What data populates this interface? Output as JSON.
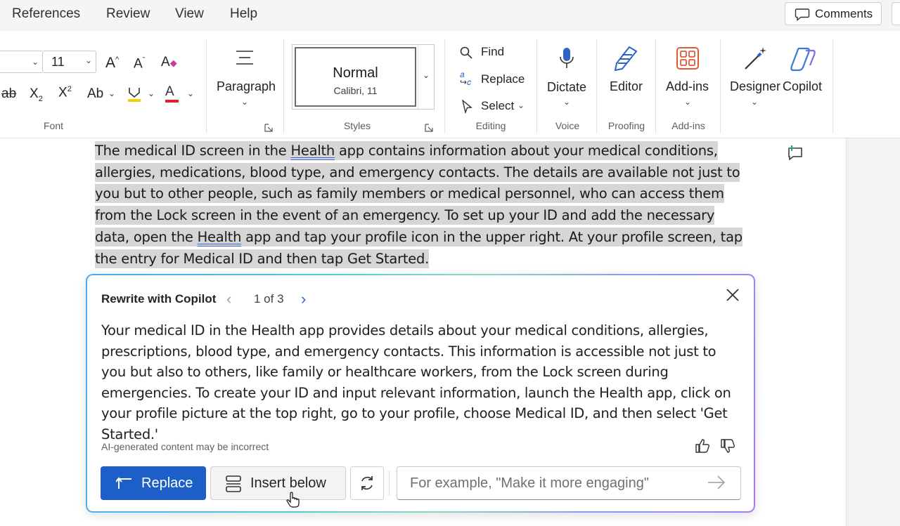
{
  "menu": {
    "items": [
      "References",
      "Review",
      "View",
      "Help"
    ],
    "comments_label": "Comments"
  },
  "ribbon": {
    "font": {
      "size": "11",
      "group_label": "Font",
      "grow_icon": "A^",
      "shrink_icon": "Aˇ",
      "change_case": "Aa",
      "subscript": "X2",
      "superscript": "X2"
    },
    "paragraph": {
      "label": "Paragraph"
    },
    "styles": {
      "current_style": "Normal",
      "current_font": "Calibri, 11",
      "group_label": "Styles"
    },
    "editing": {
      "find": "Find",
      "replace": "Replace",
      "select": "Select",
      "group_label": "Editing"
    },
    "voice": {
      "dictate": "Dictate",
      "group_label": "Voice"
    },
    "proofing": {
      "editor": "Editor",
      "group_label": "Proofing"
    },
    "addins": {
      "label": "Add-ins",
      "group_label": "Add-ins"
    },
    "designer": "Designer",
    "copilot": "Copilot",
    "colors": {
      "font_color_bar": "#e0202a",
      "highlight_bar": "#f2d200",
      "accent": "#1d5fc9"
    }
  },
  "document": {
    "paragraph_parts": [
      "The medical ID screen in the ",
      "Health",
      " app contains information about your medical conditions, allergies, medications, blood type, and emergency contacts. The details are available not just to you but to other people, such as family members or medical personnel, who can access them from the Lock screen in the event of an emergency. To set up your ID and add the necessary data, open the ",
      "Health",
      " app and tap your profile icon in the upper right. At your profile screen, tap the entry for Medical ID and then tap Get Started."
    ]
  },
  "copilot_card": {
    "title": "Rewrite with Copilot",
    "pager": "1 of 3",
    "rewrite_text": "Your medical ID in the Health app provides details about your medical conditions, allergies, prescriptions, blood type, and emergency contacts. This information is accessible not just to you but also to others, like family or healthcare workers, from the Lock screen during emergencies. To create your ID and input relevant information, launch the Health app, click on your profile picture at the top right, go to your profile, choose Medical ID, and then select 'Get Started.'",
    "disclaimer": "AI-generated content may be incorrect",
    "replace_button": "Replace",
    "insert_below_button": "Insert below",
    "prompt_placeholder": "For example, \"Make it more engaging\""
  }
}
